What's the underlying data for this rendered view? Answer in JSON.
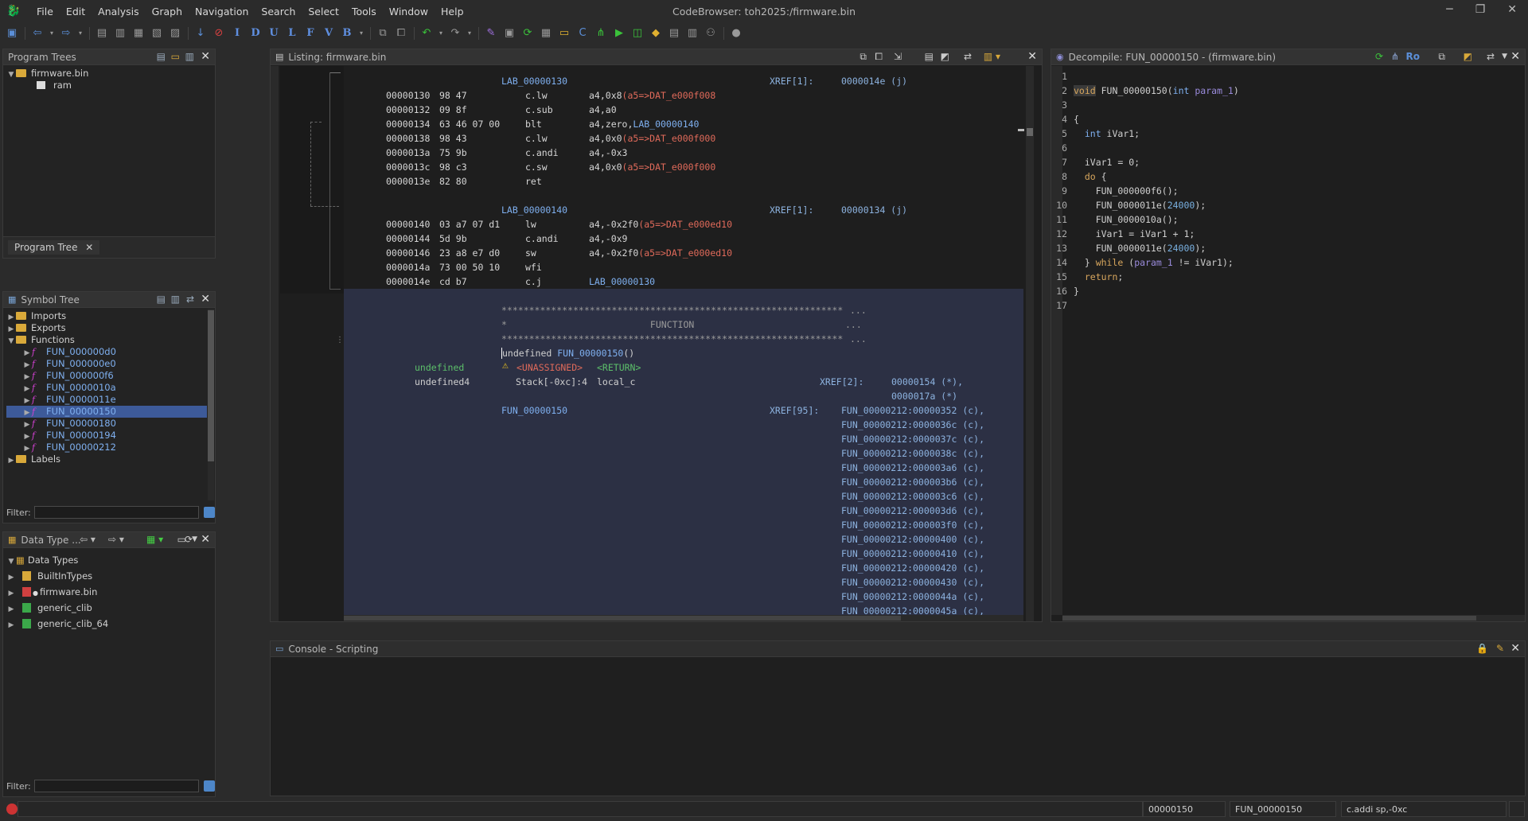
{
  "window": {
    "title": "CodeBrowser: toh2025:/firmware.bin",
    "controls": [
      "─",
      "❐",
      "✕"
    ]
  },
  "menu": [
    "File",
    "Edit",
    "Analysis",
    "Graph",
    "Navigation",
    "Search",
    "Select",
    "Tools",
    "Window",
    "Help"
  ],
  "program_trees": {
    "title": "Program Trees",
    "root": "firmware.bin",
    "child": "ram",
    "tab": "Program Tree"
  },
  "symbol_tree": {
    "title": "Symbol Tree",
    "items": [
      "Imports",
      "Exports",
      "Functions"
    ],
    "functions": [
      "FUN_000000d0",
      "FUN_000000e0",
      "FUN_000000f6",
      "FUN_0000010a",
      "FUN_0000011e",
      "FUN_00000150",
      "FUN_00000180",
      "FUN_00000194",
      "FUN_00000212"
    ],
    "selected_function": "FUN_00000150",
    "labels": "Labels",
    "filter_label": "Filter:"
  },
  "data_types": {
    "title": "Data Type ...",
    "root": "Data Types",
    "items": [
      "BuiltInTypes",
      "firmware.bin",
      "generic_clib",
      "generic_clib_64"
    ],
    "filter_label": "Filter:"
  },
  "listing": {
    "title": "Listing:  firmware.bin",
    "lab1": "LAB_00000130",
    "lab1_xref_label": "XREF[1]:",
    "lab1_xref": "0000014e (j)",
    "block1": [
      {
        "addr": "00000130",
        "bytes": "98 47",
        "mn": "c.lw",
        "op": "a4,0x8",
        "ref": "(a5=>DAT_e000f008"
      },
      {
        "addr": "00000132",
        "bytes": "09 8f",
        "mn": "c.sub",
        "op": "a4,a0",
        "ref": ""
      },
      {
        "addr": "00000134",
        "bytes": "63 46 07 00",
        "mn": "blt",
        "op": "a4,zero,",
        "ref": "LAB_00000140"
      },
      {
        "addr": "00000138",
        "bytes": "98 43",
        "mn": "c.lw",
        "op": "a4,0x0",
        "ref": "(a5=>DAT_e000f000"
      },
      {
        "addr": "0000013a",
        "bytes": "75 9b",
        "mn": "c.andi",
        "op": "a4,-0x3",
        "ref": ""
      },
      {
        "addr": "0000013c",
        "bytes": "98 c3",
        "mn": "c.sw",
        "op": "a4,0x0",
        "ref": "(a5=>DAT_e000f000"
      },
      {
        "addr": "0000013e",
        "bytes": "82 80",
        "mn": "ret",
        "op": "",
        "ref": ""
      }
    ],
    "lab2": "LAB_00000140",
    "lab2_xref_label": "XREF[1]:",
    "lab2_xref": "00000134 (j)",
    "block2": [
      {
        "addr": "00000140",
        "bytes": "03 a7 07 d1",
        "mn": "lw",
        "op": "a4,-0x2f0",
        "ref": "(a5=>DAT_e000ed10"
      },
      {
        "addr": "00000144",
        "bytes": "5d 9b",
        "mn": "c.andi",
        "op": "a4,-0x9",
        "ref": ""
      },
      {
        "addr": "00000146",
        "bytes": "23 a8 e7 d0",
        "mn": "sw",
        "op": "a4,-0x2f0",
        "ref": "(a5=>DAT_e000ed10"
      },
      {
        "addr": "0000014a",
        "bytes": "73 00 50 10",
        "mn": "wfi",
        "op": "",
        "ref": ""
      },
      {
        "addr": "0000014e",
        "bytes": "cd b7",
        "mn": "c.j",
        "op": "",
        "ref": "LAB_00000130"
      }
    ],
    "stars": "**************************************************************",
    "ellipsis": "...",
    "func_banner": "*                          FUNCTION",
    "signature_ret": "undefined",
    "signature_name": "FUN_00000150",
    "signature_parens": "()",
    "ret_type": "undefined",
    "unassigned": "<UNASSIGNED>",
    "ret_tag": "<RETURN>",
    "local_type": "undefined4",
    "local_stack": "Stack[-0xc]:4",
    "local_name": "local_c",
    "xref2_label": "XREF[2]:",
    "xref2": [
      "00000154 (*),",
      "0000017a (*)"
    ],
    "func_label": "FUN_00000150",
    "xref95_label": "XREF[95]:",
    "xref95": [
      "FUN_00000212:00000352 (c),",
      "FUN_00000212:0000036c (c),",
      "FUN_00000212:0000037c (c),",
      "FUN_00000212:0000038c (c),",
      "FUN_00000212:000003a6 (c),",
      "FUN_00000212:000003b6 (c),",
      "FUN_00000212:000003c6 (c),",
      "FUN_00000212:000003d6 (c),",
      "FUN_00000212:000003f0 (c),",
      "FUN_00000212:00000400 (c),",
      "FUN_00000212:00000410 (c),",
      "FUN_00000212:00000420 (c),",
      "FUN_00000212:00000430 (c),",
      "FUN_00000212:0000044a (c),",
      "FUN_00000212:0000045a (c),"
    ]
  },
  "decompile": {
    "title": "Decompile: FUN_00000150 -  (firmware.bin)",
    "line_numbers": [
      "1",
      "2",
      "3",
      "4",
      "5",
      "6",
      "7",
      "8",
      "9",
      "10",
      "11",
      "12",
      "13",
      "14",
      "15",
      "16",
      "17"
    ],
    "code": {
      "l2_kw": "void",
      "l2_name": " FUN_00000150",
      "l2_open": "(",
      "l2_type": "int",
      "l2_param": "param_1",
      "l2_close": ")",
      "l4": "{",
      "l5_type": "  int",
      "l5_var": " iVar1;",
      "l7": "  iVar1 = 0;",
      "l8_kw": "  do",
      "l8_rest": " {",
      "l9": "    FUN_000000f6();",
      "l10_a": "    FUN_0000011e(",
      "l10_num": "24000",
      "l10_b": ");",
      "l11": "    FUN_0000010a();",
      "l12": "    iVar1 = iVar1 + 1;",
      "l13_a": "    FUN_0000011e(",
      "l13_num": "24000",
      "l13_b": ");",
      "l14_a": "  } ",
      "l14_kw": "while",
      "l14_b": " (",
      "l14_param": "param_1",
      "l14_c": " != iVar1);",
      "l15_kw": "  return",
      "l15_b": ";",
      "l16": "}"
    }
  },
  "console": {
    "title": "Console - Scripting"
  },
  "status": {
    "address": "00000150",
    "function": "FUN_00000150",
    "instruction": "c.addi sp,-0xc"
  },
  "colors": {
    "background": "#2b2b2b",
    "panel": "#232323",
    "selection": "#3d5a99",
    "label_blue": "#7fb0f0",
    "ref_red": "#e06a5a",
    "keyword": "#d7a65d"
  }
}
